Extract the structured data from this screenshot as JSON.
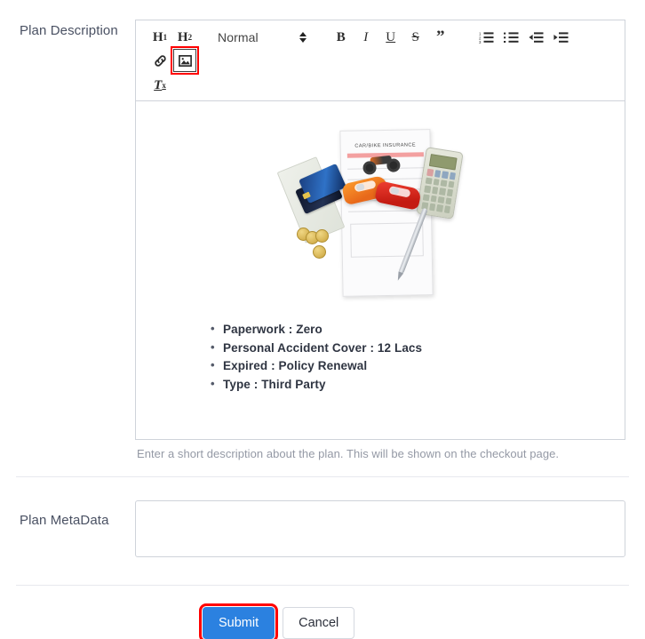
{
  "form": {
    "description": {
      "label": "Plan Description",
      "help_text": "Enter a short description about the plan. This will be shown on the checkout page."
    },
    "metadata": {
      "label": "Plan MetaData",
      "value": "",
      "placeholder": ""
    }
  },
  "editor": {
    "toolbar": {
      "h1": "H",
      "h1_sub": "1",
      "h2": "H",
      "h2_sub": "2",
      "format_picker": "Normal",
      "bold": "B",
      "italic": "I",
      "underline": "U",
      "strike": "S",
      "blockquote": "”",
      "ordered_list": "ordered-list-icon",
      "bullet_list": "bullet-list-icon",
      "outdent": "outdent-icon",
      "indent": "indent-icon",
      "link": "link-icon",
      "image": "image-icon",
      "clear_format": "T",
      "clear_format_sub": "x"
    },
    "content": {
      "image_alt": "CAR/BIKE INSURANCE form with toy cars, motorcycle, credit cards, cash, coins, calculator and pen",
      "image_caption_text": "CAR/BIKE INSURANCE",
      "bullets": [
        "Paperwork : Zero",
        "Personal Accident Cover : 12 Lacs",
        "Expired : Policy Renewal",
        "Type : Third Party"
      ]
    }
  },
  "actions": {
    "submit": "Submit",
    "cancel": "Cancel"
  },
  "colors": {
    "primary": "#2b81e0",
    "highlight": "#ff0000",
    "border": "#cfd3da",
    "label_text": "#4a5163",
    "help_text": "#9499a5"
  }
}
